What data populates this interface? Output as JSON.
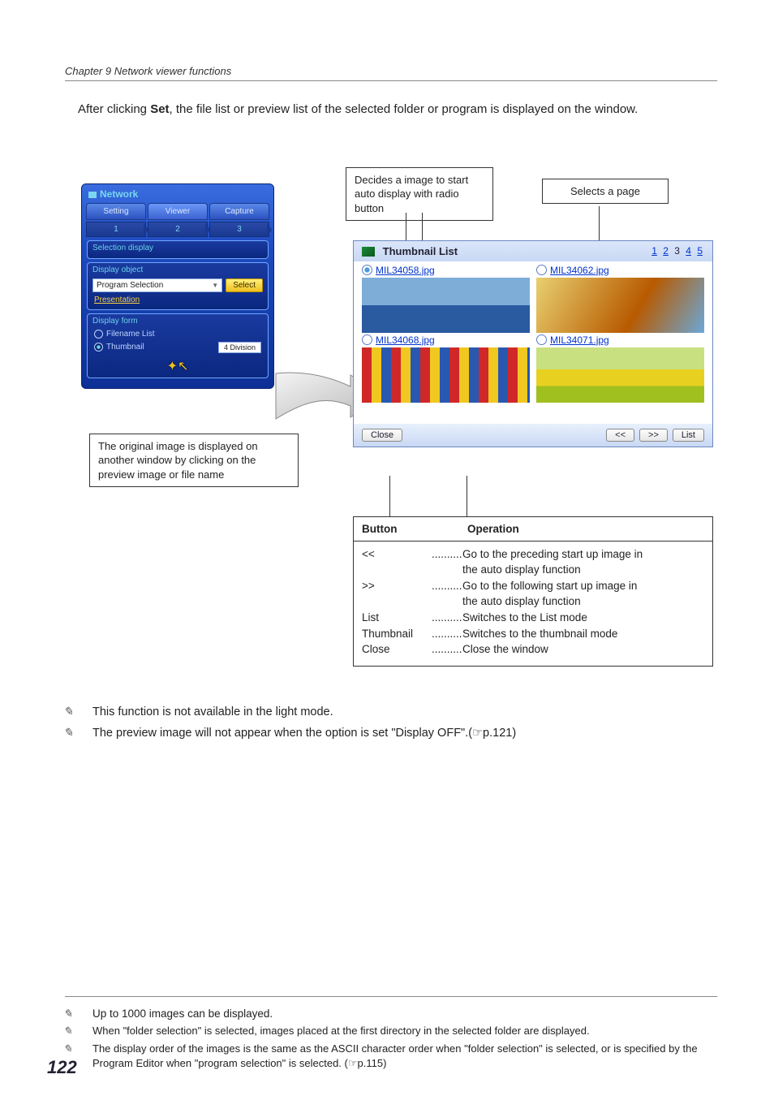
{
  "chapter": "Chapter 9 Network viewer functions",
  "intro_before": "After clicking ",
  "intro_bold": "Set",
  "intro_after": ", the file list or preview list of the selected folder or program is displayed on the window.",
  "page_number": "122",
  "callouts": {
    "radio": "Decides a image to start auto display with radio button",
    "page": "Selects a page",
    "original": "The original image is displayed on another window by clicking on the preview image or file name"
  },
  "network_panel": {
    "title": "Network",
    "tabs": [
      "Setting",
      "Viewer",
      "Capture"
    ],
    "subtabs": [
      "1",
      "2",
      "3"
    ],
    "selection_display": "Selection display",
    "display_object": "Display object",
    "dropdown_value": "Program Selection",
    "select_btn": "Select",
    "presentation": "Presentation",
    "display_form": "Display form",
    "filename_list": "Filename List",
    "thumbnail": "Thumbnail",
    "division": "4 Division"
  },
  "thumb_window": {
    "title": "Thumbnail List",
    "pages": [
      "1",
      "2",
      "3",
      "4",
      "5"
    ],
    "items": [
      {
        "name": "MIL34058.jpg",
        "selected": true
      },
      {
        "name": "MIL34062.jpg",
        "selected": false
      },
      {
        "name": "MIL34068.jpg",
        "selected": false
      },
      {
        "name": "MIL34071.jpg",
        "selected": false
      }
    ],
    "close": "Close",
    "prev": "<<",
    "next": ">>",
    "list": "List"
  },
  "op_table": {
    "head_button": "Button",
    "head_operation": "Operation",
    "rows": [
      {
        "b": "<<",
        "d1": "Go to the preceding start up image in",
        "d2": "the auto display function"
      },
      {
        "b": ">>",
        "d1": "Go to the following start up image in",
        "d2": "the auto display function"
      },
      {
        "b": "List",
        "d1": "Switches to the List mode",
        "d2": ""
      },
      {
        "b": "Thumbnail",
        "d1": "Switches to the thumbnail mode",
        "d2": ""
      },
      {
        "b": "Close",
        "d1": "Close the window",
        "d2": ""
      }
    ]
  },
  "notes": {
    "n1": "This function is not available in the light mode.",
    "n2": "The preview image will not appear when the option is set \"Display OFF\".(☞p.121)"
  },
  "footer_notes": {
    "f1": "Up to 1000 images can be displayed.",
    "f2": "When \"folder selection\" is selected, images placed at the first directory in the selected folder are displayed.",
    "f3": "The display order of the images is the same as the ASCII character order when \"folder selection\" is selected, or is specified by the Program Editor when \"program selection\" is selected. (☞p.115)"
  }
}
